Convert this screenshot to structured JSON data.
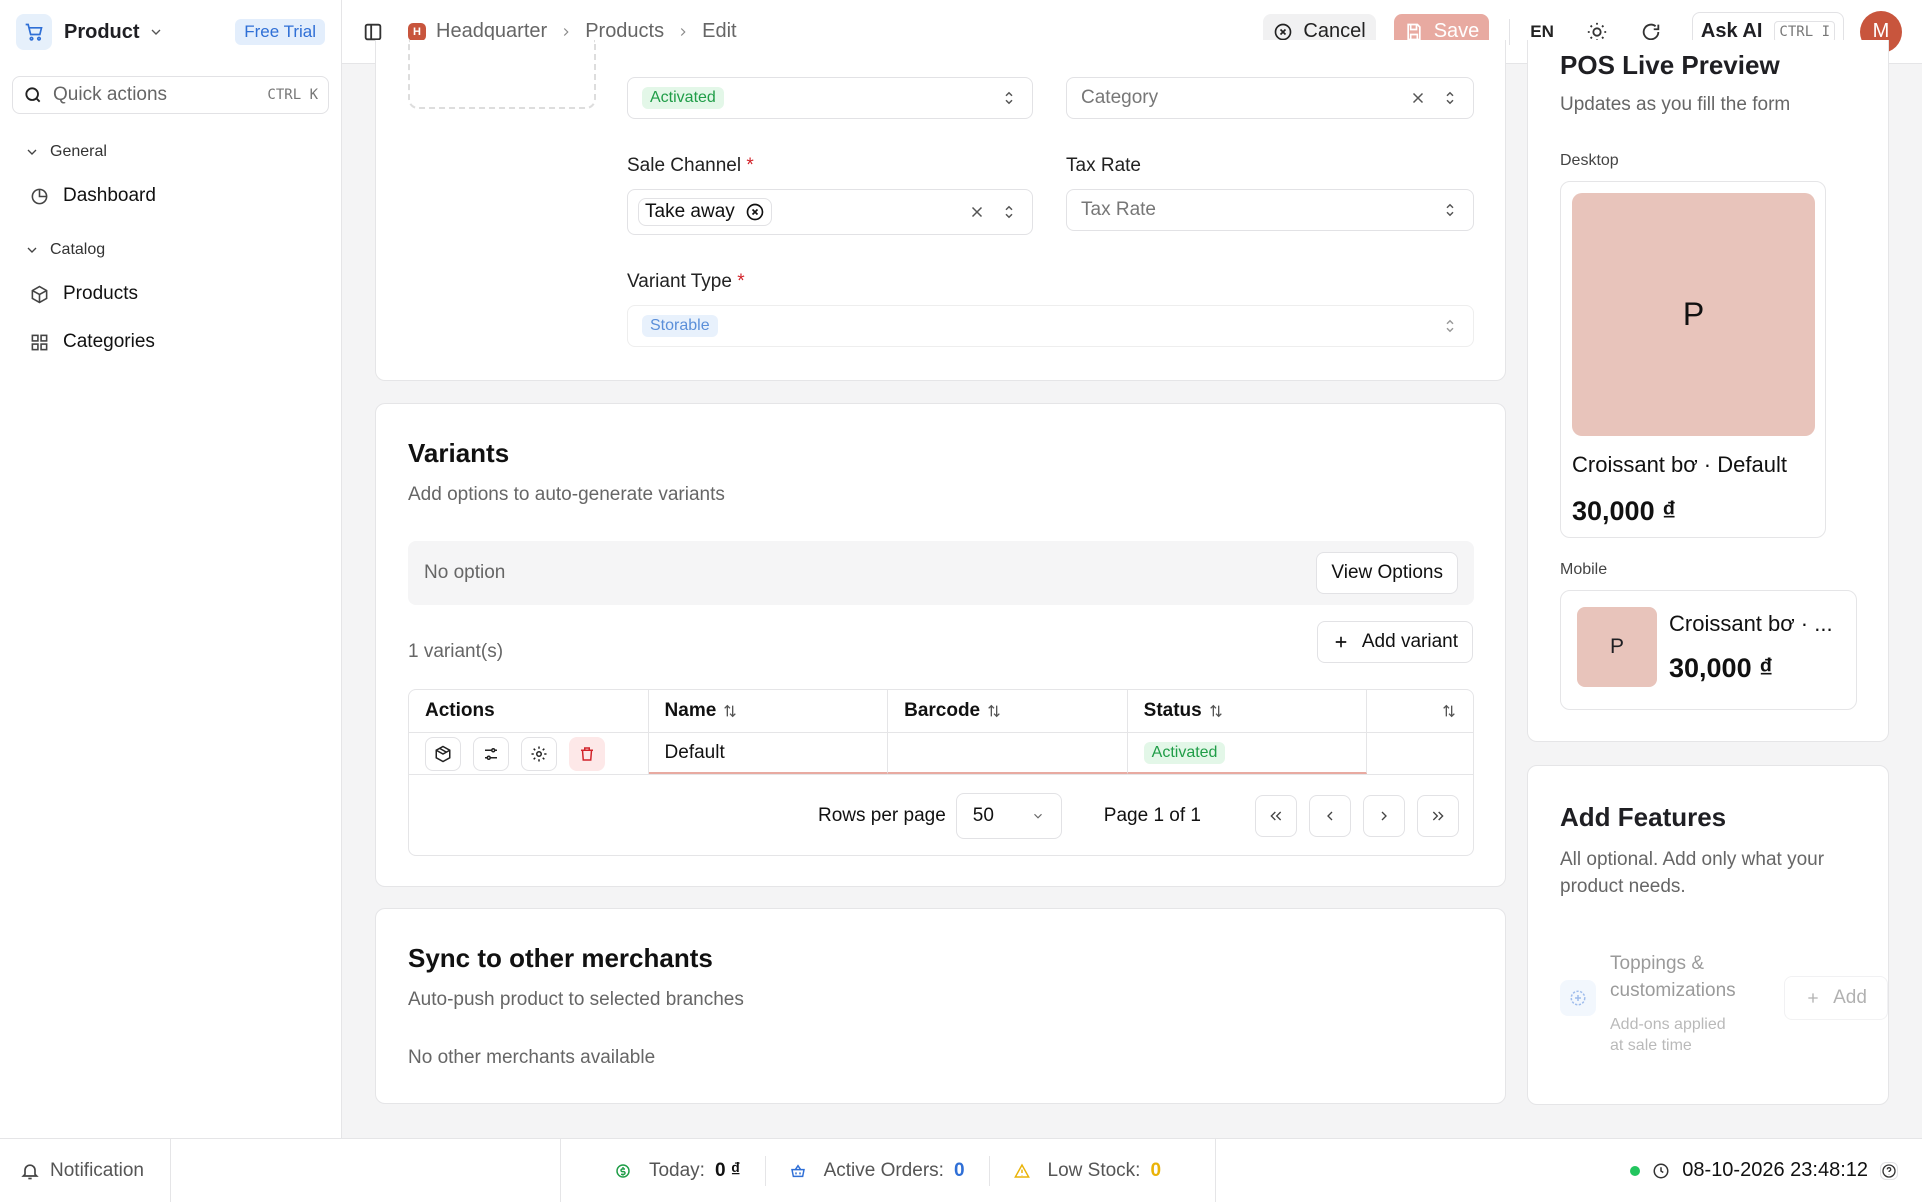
{
  "app": {
    "name": "Product",
    "trial": "Free Trial",
    "quick_actions": "Quick actions",
    "quick_kbd": "CTRL K"
  },
  "sidebar": {
    "groups": [
      {
        "label": "General",
        "items": [
          {
            "label": "Dashboard",
            "icon": "pie-chart-icon"
          }
        ]
      },
      {
        "label": "Catalog",
        "items": [
          {
            "label": "Products",
            "icon": "box-icon"
          },
          {
            "label": "Categories",
            "icon": "grid-icon"
          }
        ]
      }
    ]
  },
  "topbar": {
    "hq_badge": "H",
    "breadcrumbs": [
      "Headquarter",
      "Products",
      "Edit"
    ],
    "cancel": "Cancel",
    "save": "Save",
    "lang": "EN",
    "ask_ai": "Ask AI",
    "ask_kbd": "CTRL I",
    "avatar": "M"
  },
  "form": {
    "status_value": "Activated",
    "category_placeholder": "Category",
    "sale_channel_label": "Sale Channel",
    "sale_channel_chip": "Take away",
    "tax_rate_label": "Tax Rate",
    "tax_rate_placeholder": "Tax Rate",
    "variant_type_label": "Variant Type",
    "variant_type_value": "Storable",
    "required_mark": "*"
  },
  "variants": {
    "title": "Variants",
    "subtitle": "Add options to auto-generate variants",
    "no_option": "No option",
    "view_options": "View Options",
    "count": "1 variant(s)",
    "add_variant": "Add variant",
    "columns": [
      "Actions",
      "Name",
      "Barcode",
      "Status"
    ],
    "rows": [
      {
        "name": "Default",
        "barcode": "",
        "status": "Activated"
      }
    ],
    "rows_per_page_label": "Rows per page",
    "rows_per_page": "50",
    "page_info": "Page 1 of 1"
  },
  "sync": {
    "title": "Sync to other merchants",
    "subtitle": "Auto-push product to selected branches",
    "empty": "No other merchants available"
  },
  "preview": {
    "title": "POS Live Preview",
    "subtitle": "Updates as you fill the form",
    "desktop_label": "Desktop",
    "mobile_label": "Mobile",
    "initial": "P",
    "product_name": "Croissant bơ · Default",
    "mobile_name": "Croissant bơ · ...",
    "price": "30,000 ₫"
  },
  "features": {
    "title": "Add Features",
    "subtitle": "All optional. Add only what your product needs.",
    "item_name": "Toppings & customizations",
    "item_desc": "Add-ons applied at sale time",
    "add": "Add"
  },
  "statusbar": {
    "notification": "Notification",
    "today_label": "Today:",
    "today_value": "0 ₫",
    "orders_label": "Active Orders:",
    "orders_value": "0",
    "stock_label": "Low Stock:",
    "stock_value": "0",
    "datetime": "08-10-2026 23:48:12"
  },
  "colors": {
    "accent": "#2f6fd6",
    "brand": "#c8553d",
    "success": "#1f9d47",
    "warning": "#eab308",
    "danger": "#d2232a"
  }
}
